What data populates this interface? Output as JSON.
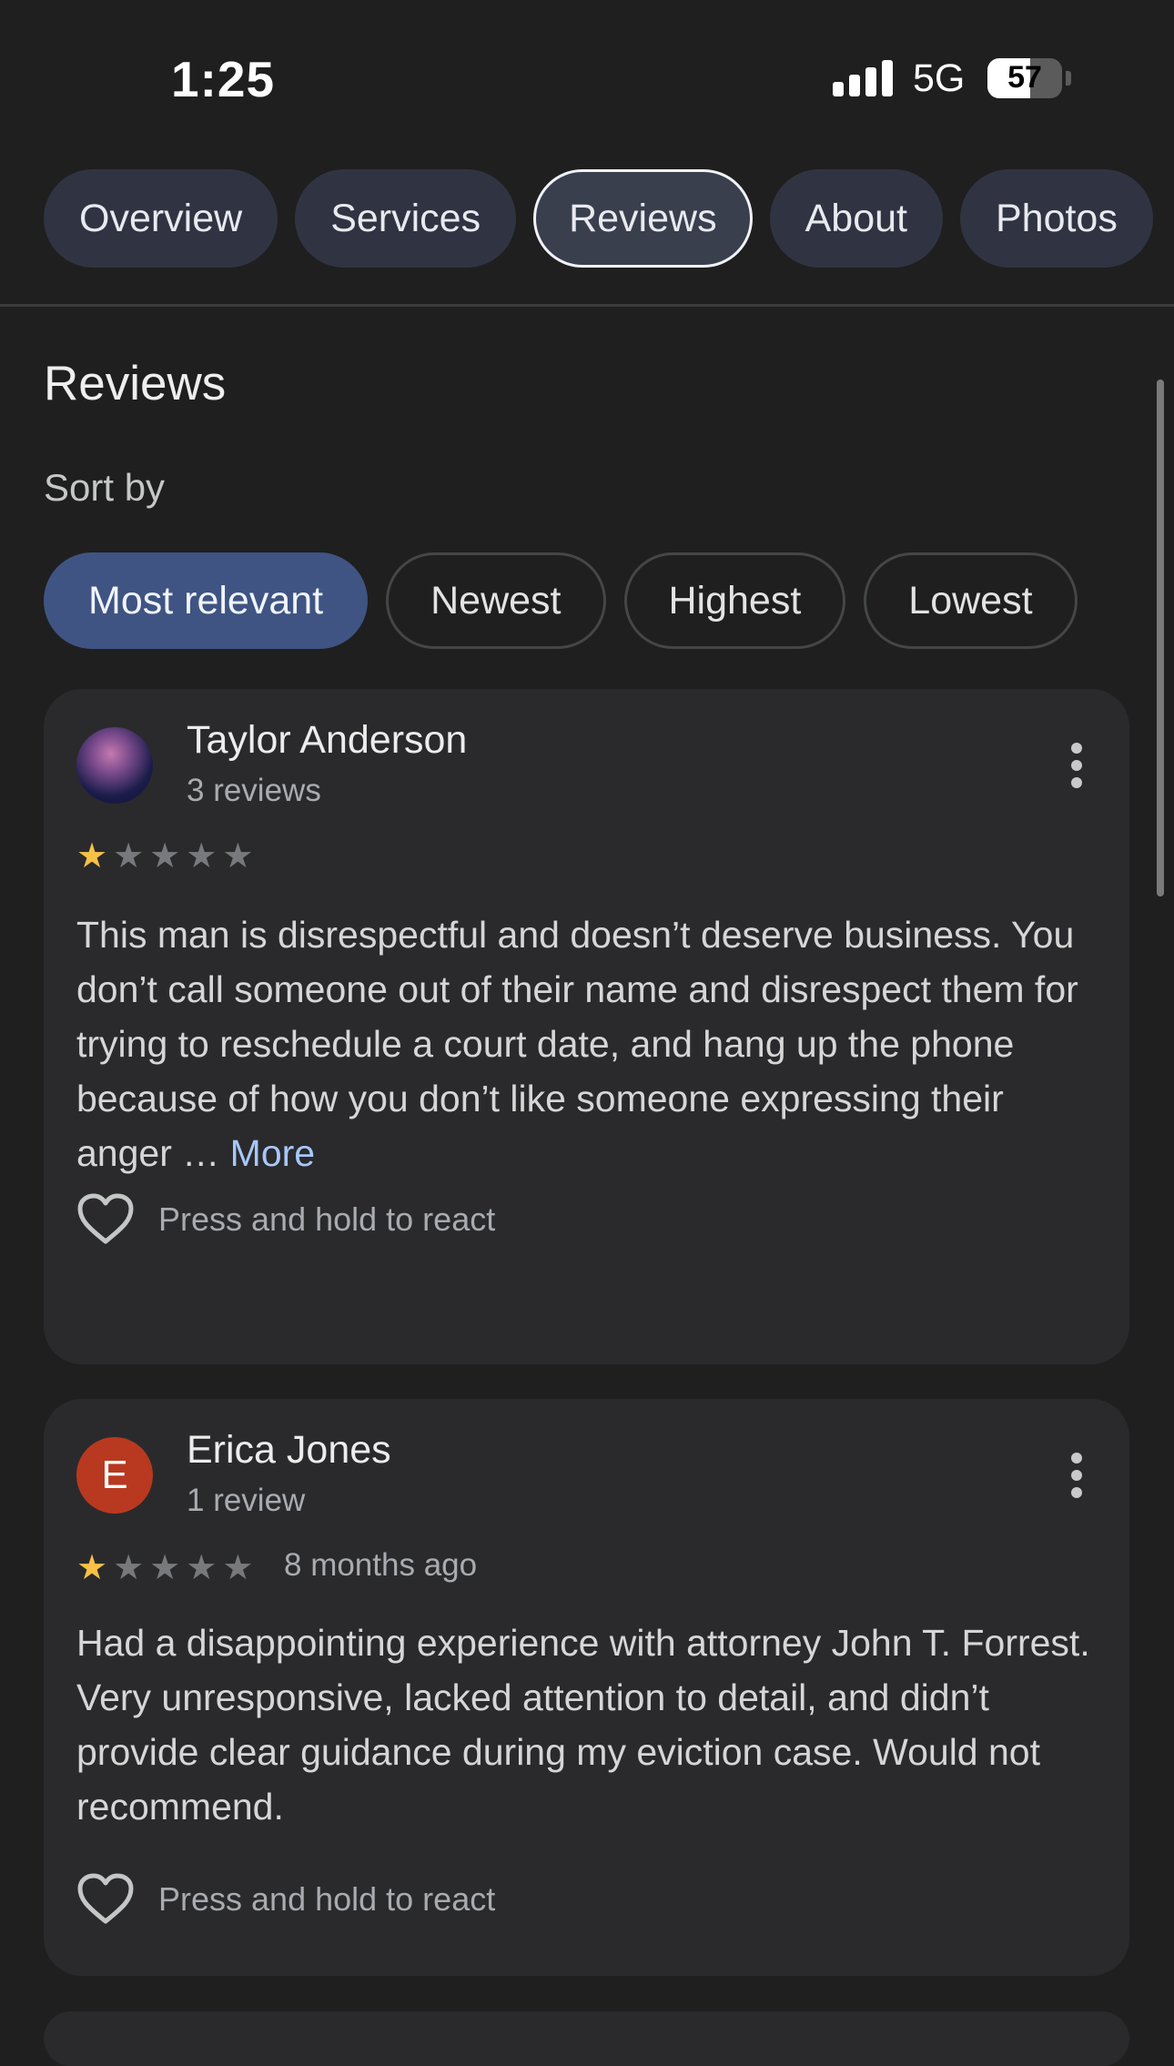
{
  "status_bar": {
    "time": "1:25",
    "network": "5G",
    "battery": "57",
    "battery_level": 0.57
  },
  "tabs": [
    {
      "label": "Overview",
      "active": false
    },
    {
      "label": "Services",
      "active": false
    },
    {
      "label": "Reviews",
      "active": true
    },
    {
      "label": "About",
      "active": false
    },
    {
      "label": "Photos",
      "active": false
    }
  ],
  "section_title": "Reviews",
  "sort": {
    "label": "Sort by",
    "options": [
      {
        "label": "Most relevant",
        "selected": true
      },
      {
        "label": "Newest",
        "selected": false
      },
      {
        "label": "Highest",
        "selected": false
      },
      {
        "label": "Lowest",
        "selected": false
      }
    ]
  },
  "reviews": [
    {
      "name": "Taylor Anderson",
      "count": "3 reviews",
      "rating": 1,
      "date": "",
      "text": "This man is disrespectful and doesn’t deserve business. You don’t call someone out of their name and disrespect them for trying to reschedule a court date, and hang up the phone because of how you don’t like someone expressing their anger …",
      "more": "More",
      "react": "Press and hold to react"
    },
    {
      "name": "Erica Jones",
      "avatar_letter": "E",
      "count": "1 review",
      "rating": 1,
      "date": "8 months ago",
      "text": "Had a disappointing experience with attorney John T. Forrest. Very unresponsive, lacked attention to detail, and didn’t provide clear guidance during my eviction case. Would not recommend.",
      "react": "Press and hold to react"
    }
  ],
  "colors": {
    "background": "#1f1f1f",
    "card": "#2a2a2c",
    "accent_chip": "#3f5482",
    "star": "#f6c146",
    "link": "#a8c7fa"
  }
}
